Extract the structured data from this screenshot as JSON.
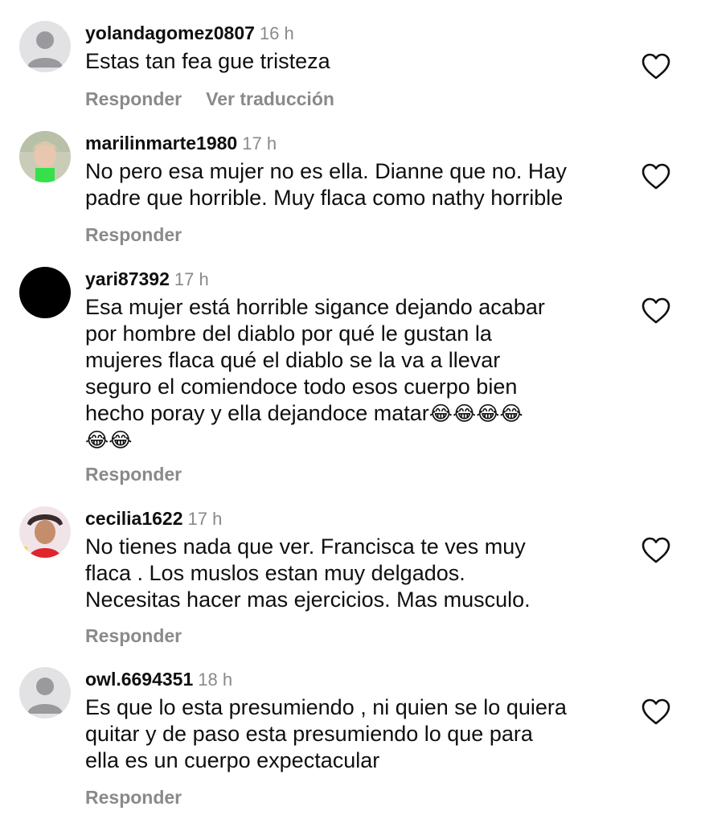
{
  "comments": [
    {
      "username": "yolandagomez0807",
      "time": "16 h",
      "avatar": "default-avatar",
      "lines": [
        "Estas tan fea gue tristeza"
      ],
      "actions": {
        "reply": "Responder",
        "translate": "Ver traducción"
      }
    },
    {
      "username": "marilinmarte1980",
      "time": "17 h",
      "avatar": "photo-avatar",
      "lines": [
        "No pero esa mujer no es ella. Dianne que no. Hay",
        "padre que horrible. Muy flaca como nathy horrible"
      ],
      "actions": {
        "reply": "Responder"
      }
    },
    {
      "username": "yari87392",
      "time": "17 h",
      "avatar": "black-avatar",
      "lines": [
        "Esa mujer está horrible sigance dejando acabar",
        "por hombre del diablo por qué le gustan la",
        "mujeres flaca qué el diablo se la va a llevar",
        "seguro el comiendoce todo esos cuerpo bien",
        "hecho poray y ella dejandoce matar",
        ""
      ],
      "emoji_line5": "😂😂😂😂",
      "emoji_line6": "😂😂",
      "actions": {
        "reply": "Responder"
      }
    },
    {
      "username": "cecilia1622",
      "time": "17 h",
      "avatar": "photo-avatar",
      "lines": [
        "No tienes nada que ver.  Francisca te ves muy",
        "flaca . Los muslos estan muy delgados.",
        "Necesitas hacer mas ejercicios. Mas musculo."
      ],
      "actions": {
        "reply": "Responder"
      }
    },
    {
      "username": "owl.6694351",
      "time": "18 h",
      "avatar": "default-avatar",
      "lines": [
        "Es que lo esta presumiendo , ni quien se lo quiera",
        "quitar y de paso esta presumiendo lo que para",
        "ella es un cuerpo expectacular"
      ],
      "actions": {
        "reply": "Responder"
      }
    }
  ],
  "colors": {
    "text": "#0f0f0f",
    "muted": "#8a8a8a",
    "default_avatar_bg": "#e2e2e4",
    "default_avatar_fg": "#9a9a9e"
  },
  "icons": {
    "like": "heart-outline-icon"
  }
}
